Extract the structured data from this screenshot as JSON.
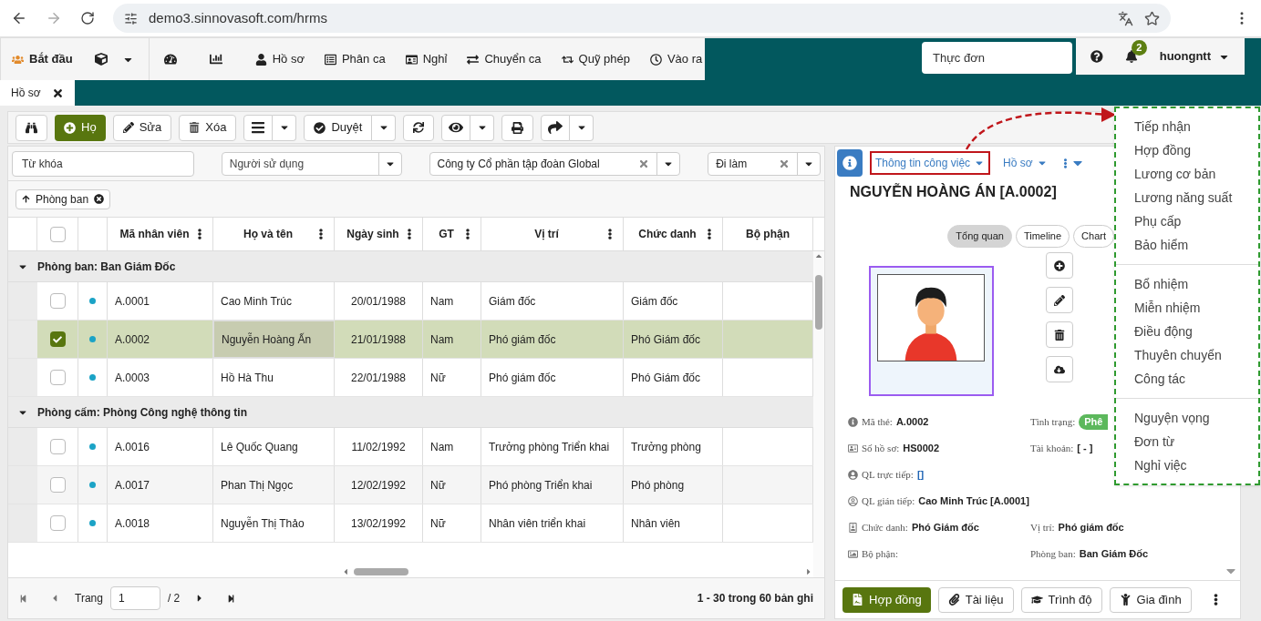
{
  "browser": {
    "url": "demo3.sinnovasoft.com/hrms"
  },
  "nav": {
    "start": "Bắt đầu",
    "items": [
      "Hồ sơ",
      "Phân ca",
      "Nghỉ",
      "Chuyển ca",
      "Quỹ phép",
      "Vào ra"
    ],
    "menu_search": {
      "placeholder": "Thực đơn"
    },
    "notifications": "2",
    "user": "huongntt"
  },
  "tabs": [
    {
      "label": "Hồ sơ",
      "selected": true
    }
  ],
  "toolbar": {
    "add": "Họ",
    "edit": "Sửa",
    "delete": "Xóa",
    "approve": "Duyệt"
  },
  "filters": {
    "keyword": {
      "placeholder": "Từ khóa"
    },
    "user": {
      "placeholder": "Người sử dụng"
    },
    "company": {
      "value": "Công ty Cổ phần tập đoàn Global"
    },
    "status": {
      "value": "Đi làm"
    }
  },
  "group_chip": "Phòng ban",
  "table": {
    "select_all": {
      "checked": false
    },
    "columns": [
      "Mã nhân viên",
      "Họ và tên",
      "Ngày sinh",
      "GT",
      "Vị trí",
      "Chức danh",
      "Bộ phận"
    ],
    "groups": [
      {
        "label": "Phòng ban: Ban Giám Đốc",
        "expanded": true,
        "rows": [
          {
            "selected": false,
            "checked": false,
            "cells": [
              "A.0001",
              "Cao Minh Trúc",
              "20/01/1988",
              "Nam",
              "Giám đốc",
              "Giám đốc"
            ]
          },
          {
            "selected": true,
            "checked": true,
            "cells": [
              "A.0002",
              "Nguyễn Hoàng Ấn",
              "21/01/1988",
              "Nam",
              "Phó giám đốc",
              "Phó Giám đốc"
            ]
          },
          {
            "selected": false,
            "checked": false,
            "cells": [
              "A.0003",
              "Hồ Hà Thu",
              "22/01/1988",
              "Nữ",
              "Phó giám đốc",
              "Phó Giám đốc"
            ]
          }
        ]
      },
      {
        "label": "Phòng cấm: Phòng Công nghệ thông tin",
        "expanded": true,
        "rows": [
          {
            "selected": false,
            "checked": false,
            "cells": [
              "A.0016",
              "Lê Quốc Quang",
              "11/02/1992",
              "Nam",
              "Trưởng phòng Triển khai",
              "Trưởng phòng"
            ]
          },
          {
            "selected": false,
            "checked": false,
            "cells": [
              "A.0017",
              "Phan Thị Ngọc",
              "12/02/1992",
              "Nữ",
              "Phó phòng Triển khai",
              "Phó phòng"
            ]
          },
          {
            "selected": false,
            "checked": false,
            "cells": [
              "A.0018",
              "Nguyễn Thị Thảo",
              "13/02/1992",
              "Nữ",
              "Nhân viên triển khai",
              "Nhân viên"
            ]
          }
        ]
      }
    ]
  },
  "pager": {
    "label": "Trang",
    "page": "1",
    "total": "/ 2",
    "summary": "1 - 30 trong 60 bản ghi"
  },
  "detail": {
    "menus": [
      {
        "label": "Thông tin công việc",
        "selected": true
      },
      {
        "label": "Hồ sơ",
        "selected": false
      }
    ],
    "title": "NGUYỄN HOÀNG ÁN [A.0002]",
    "views": [
      {
        "label": "Tổng quan",
        "selected": true
      },
      {
        "label": "Timeline",
        "selected": false
      },
      {
        "label": "Chart",
        "selected": false
      }
    ],
    "field_rows": [
      [
        {
          "label": "Mã thẻ:",
          "value": "A.0002",
          "kind": "text"
        },
        {
          "label": "Tình trạng:",
          "value": "Phê",
          "kind": "badge"
        }
      ],
      [
        {
          "label": "Số hồ sơ:",
          "value": "HS0002",
          "kind": "text"
        },
        {
          "label": "Tài khoản:",
          "value": "[ - ]",
          "kind": "text"
        }
      ],
      [
        {
          "label": "QL trực tiếp:",
          "value": "[]",
          "kind": "link"
        }
      ],
      [
        {
          "label": "QL gián tiếp:",
          "value": "Cao Minh Trúc [A.0001]",
          "kind": "text"
        }
      ],
      [
        {
          "label": "Chức danh:",
          "value": "Phó Giám đốc",
          "kind": "text"
        },
        {
          "label": "Vị trí:",
          "value": "Phó giám đốc",
          "kind": "text"
        }
      ],
      [
        {
          "label": "Bộ phận:"
        },
        {
          "label": "Phòng ban:",
          "value": "Ban Giám Đốc",
          "kind": "text"
        }
      ]
    ],
    "bottom_buttons": [
      {
        "label": "Hợp đồng",
        "selected": true
      },
      {
        "label": "Tài liệu",
        "selected": false
      },
      {
        "label": "Trình độ",
        "selected": false
      },
      {
        "label": "Gia đình",
        "selected": false
      }
    ]
  },
  "dropdown": {
    "sections": [
      [
        "Tiếp nhận",
        "Hợp đồng",
        "Lương cơ bản",
        "Lương năng suất",
        "Phụ cấp",
        "Bảo hiểm"
      ],
      [
        "Bổ nhiệm",
        "Miễn nhiệm",
        "Điều động",
        "Thuyên chuyển",
        "Công tác"
      ],
      [
        "Nguyện vọng",
        "Đơn từ",
        "Nghỉ việc"
      ]
    ]
  }
}
